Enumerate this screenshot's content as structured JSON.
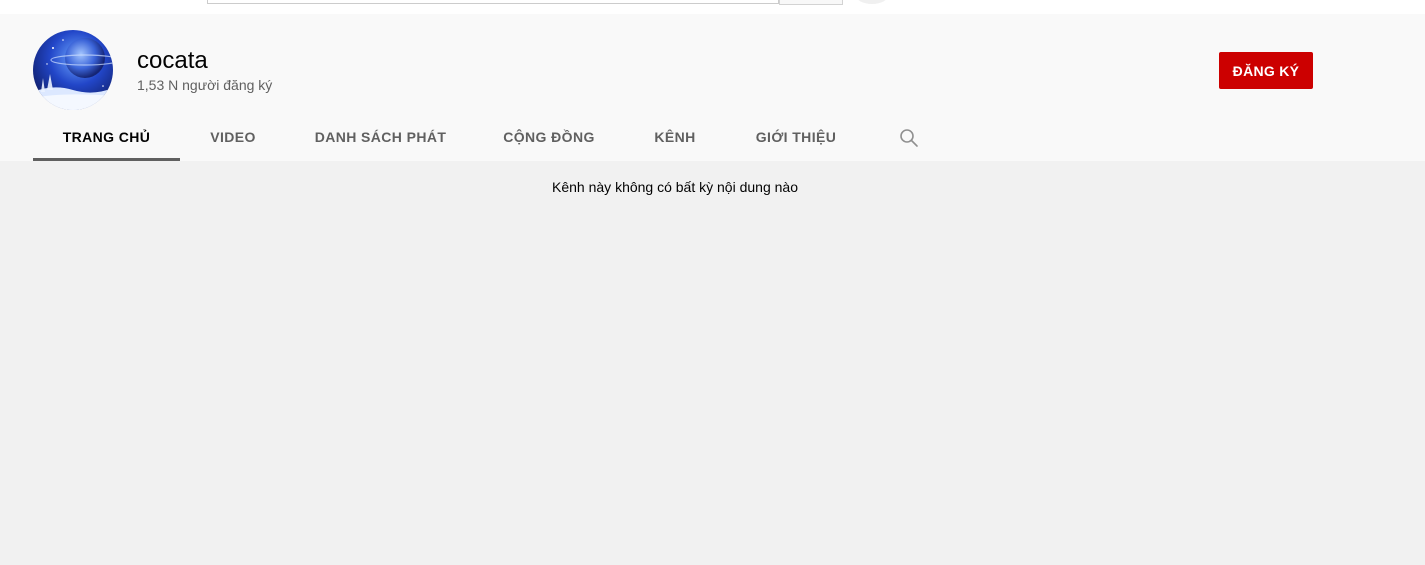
{
  "channel": {
    "name": "cocata",
    "subscribers": "1,53 N người đăng ký",
    "subscribe_label": "ĐĂNG KÝ",
    "avatar_icon": "planet-night-sky-avatar"
  },
  "tabs": [
    {
      "label": "TRANG CHỦ",
      "active": true
    },
    {
      "label": "VIDEO",
      "active": false
    },
    {
      "label": "DANH SÁCH PHÁT",
      "active": false
    },
    {
      "label": "CỘNG ĐỒNG",
      "active": false
    },
    {
      "label": "KÊNH",
      "active": false
    },
    {
      "label": "GIỚI THIỆU",
      "active": false
    }
  ],
  "content": {
    "empty_message": "Kênh này không có bất kỳ nội dung nào"
  },
  "colors": {
    "subscribe": "#cc0000",
    "active_tab_underline": "#606060",
    "header_bg": "#f9f9f9",
    "page_bg": "#f1f1f1"
  }
}
